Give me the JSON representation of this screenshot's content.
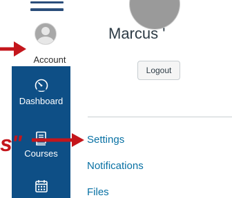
{
  "nav": {
    "account_label": "Account",
    "dashboard_label": "Dashboard",
    "courses_label": "Courses",
    "icons": {
      "hamburger": "hamburger-icon",
      "account": "user-avatar-icon",
      "dashboard": "gauge-icon",
      "courses": "book-icon",
      "calendar": "calendar-icon"
    },
    "color": "#0e4f86"
  },
  "tray": {
    "user_name": "Marcus '",
    "logout_label": "Logout",
    "links": [
      "Settings",
      "Notifications",
      "Files"
    ],
    "link_color": "#0770a3"
  },
  "annotation": {
    "quote_text": "s\"",
    "color": "#c4161c"
  }
}
